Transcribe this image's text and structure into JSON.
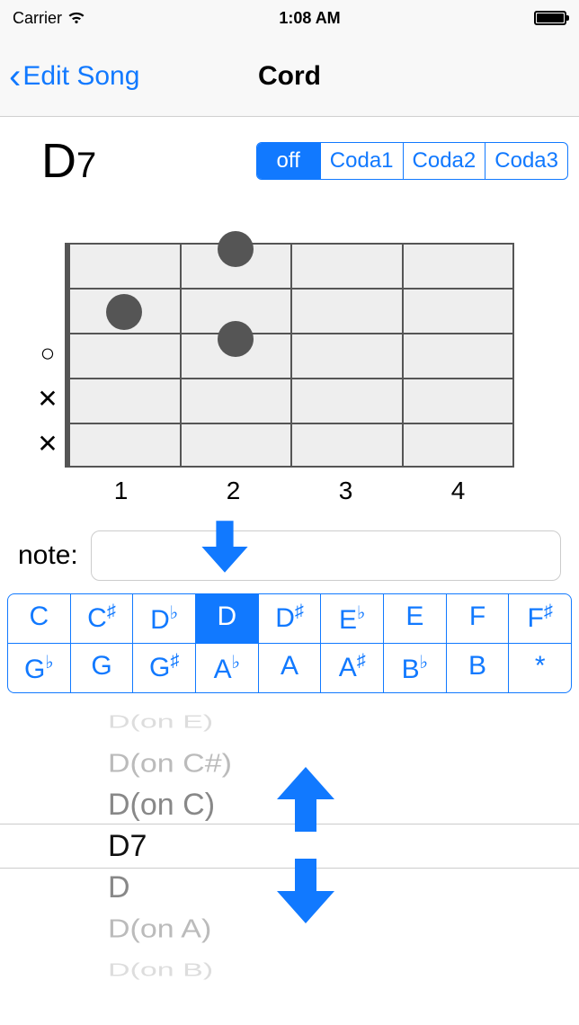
{
  "status": {
    "carrier": "Carrier",
    "time": "1:08 AM"
  },
  "nav": {
    "back": "Edit Song",
    "title": "Cord"
  },
  "chord": {
    "root": "D",
    "suffix": "7"
  },
  "coda": {
    "items": [
      "off",
      "Coda1",
      "Coda2",
      "Coda3"
    ],
    "selected": 0
  },
  "fret": {
    "labels": [
      "1",
      "2",
      "3",
      "4"
    ],
    "markers": [
      "",
      "",
      "○",
      "✕",
      "✕"
    ]
  },
  "note": {
    "label": "note:",
    "value": ""
  },
  "roots": {
    "row1": [
      {
        "base": "C",
        "acc": ""
      },
      {
        "base": "C",
        "acc": "♯"
      },
      {
        "base": "D",
        "acc": "♭"
      },
      {
        "base": "D",
        "acc": ""
      },
      {
        "base": "D",
        "acc": "♯"
      },
      {
        "base": "E",
        "acc": "♭"
      },
      {
        "base": "E",
        "acc": ""
      },
      {
        "base": "F",
        "acc": ""
      },
      {
        "base": "F",
        "acc": "♯"
      }
    ],
    "row2": [
      {
        "base": "G",
        "acc": "♭"
      },
      {
        "base": "G",
        "acc": ""
      },
      {
        "base": "G",
        "acc": "♯"
      },
      {
        "base": "A",
        "acc": "♭"
      },
      {
        "base": "A",
        "acc": ""
      },
      {
        "base": "A",
        "acc": "♯"
      },
      {
        "base": "B",
        "acc": "♭"
      },
      {
        "base": "B",
        "acc": ""
      },
      {
        "base": "*",
        "acc": ""
      }
    ],
    "selected": "D"
  },
  "picker": {
    "items": [
      "D(on E)",
      "D(on C#)",
      "D(on C)",
      "D7",
      "D",
      "D(on A)",
      "D(on B)"
    ],
    "selected": 3
  }
}
